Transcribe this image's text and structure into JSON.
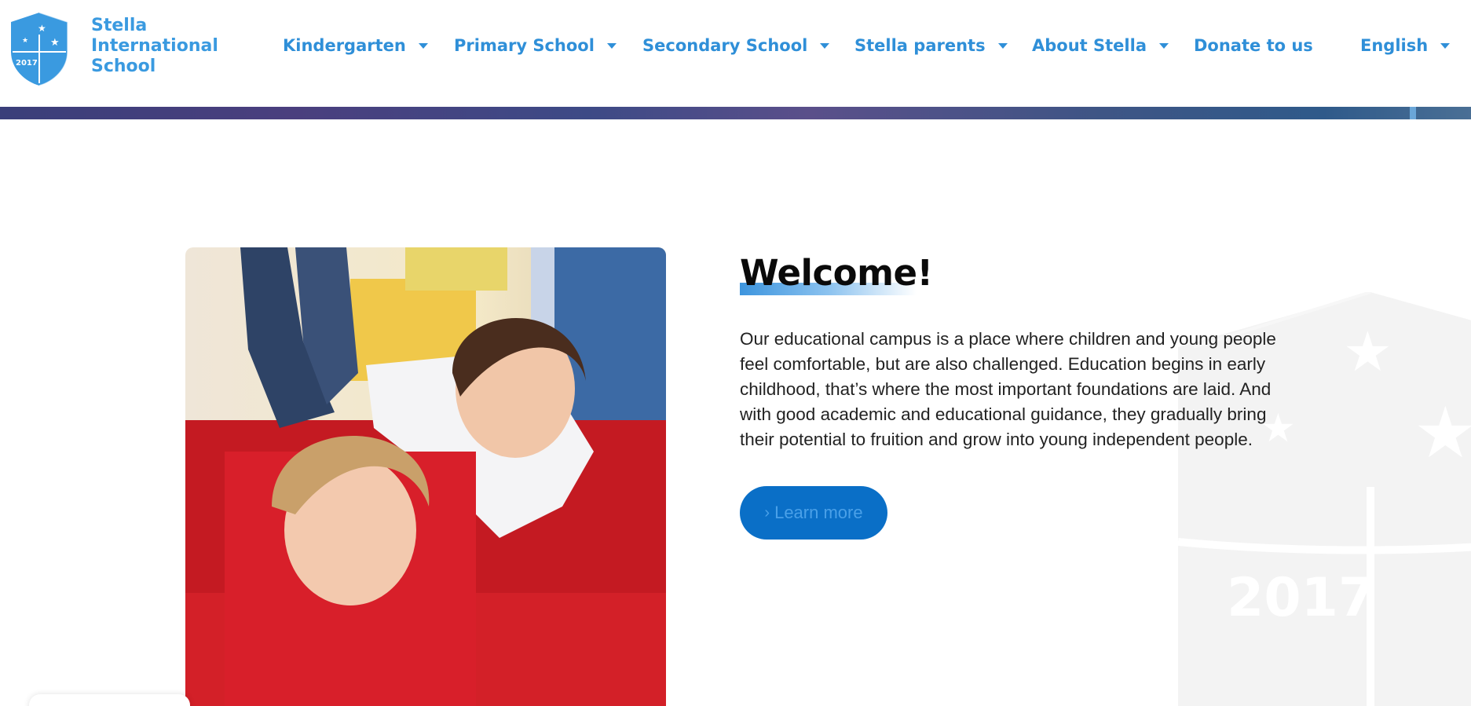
{
  "brand": {
    "name_line1": "Stella",
    "name_line2": "International",
    "name_line3": "School",
    "crest_year": "2017",
    "color": "#3a9ae0"
  },
  "nav": {
    "items": [
      {
        "label": "Kindergarten",
        "has_dropdown": true
      },
      {
        "label": "Primary School",
        "has_dropdown": true
      },
      {
        "label": "Secondary School",
        "has_dropdown": true
      },
      {
        "label": "Stella parents",
        "has_dropdown": true
      },
      {
        "label": "About Stella",
        "has_dropdown": true
      },
      {
        "label": "Donate to us",
        "has_dropdown": false
      },
      {
        "label": "English",
        "has_dropdown": true
      }
    ],
    "color": "#2f8fd8"
  },
  "welcome": {
    "title": "Welcome!",
    "paragraph": "Our educational campus is a place where children and young people feel comfortable, but are also challenged. Education begins in early childhood, that’s where the most important foundations are laid. And with good academic and educational guidance, they gradually bring their potential to fruition and grow into young independent people.",
    "button_label": "Learn more",
    "button_icon": "chevron-right-icon",
    "button_color": "#0a6fc7"
  },
  "watermark": {
    "year": "2017"
  }
}
